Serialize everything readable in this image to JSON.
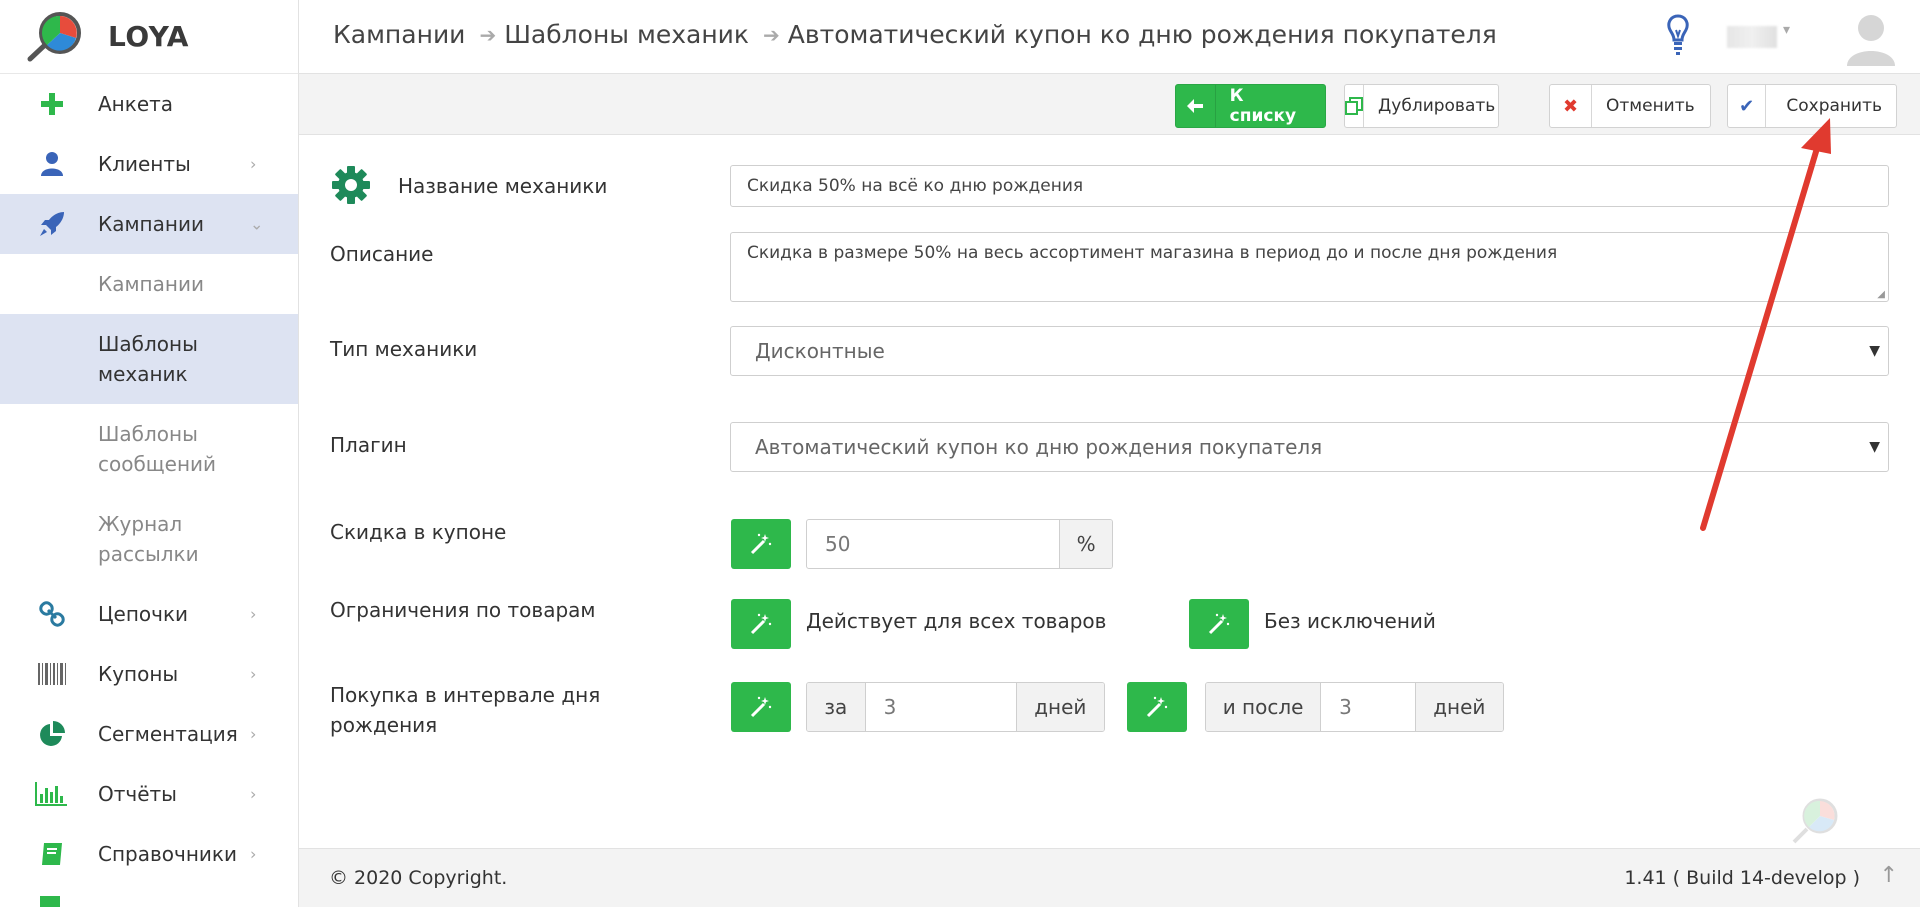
{
  "app": {
    "name": "LOYA"
  },
  "sidebar": {
    "items": [
      {
        "label": "Анкета",
        "icon": "plus-icon",
        "color": "#2eb84b"
      },
      {
        "label": "Клиенты",
        "icon": "user-icon",
        "color": "#3a64b8"
      },
      {
        "label": "Кампании",
        "icon": "rocket-icon",
        "color": "#3a64b8"
      },
      {
        "label": "Цепочки",
        "icon": "chain-icon",
        "color": "#2a7aa0"
      },
      {
        "label": "Купоны",
        "icon": "barcode-icon",
        "color": "#666666"
      },
      {
        "label": "Сегментация",
        "icon": "pie-chart-icon",
        "color": "#1e8a5a"
      },
      {
        "label": "Отчёты",
        "icon": "bar-chart-icon",
        "color": "#2eb84b"
      },
      {
        "label": "Справочники",
        "icon": "book-icon",
        "color": "#2eb84b"
      }
    ],
    "subitems": [
      {
        "label": "Кампании"
      },
      {
        "label": "Шаблоны механик"
      },
      {
        "label": "Шаблоны сообщений"
      },
      {
        "label": "Журнал рассылки"
      }
    ]
  },
  "header": {
    "breadcrumb": [
      "Кампании",
      "Шаблоны механик",
      "Автоматический купон ко дню рождения покупателя"
    ]
  },
  "toolbar": {
    "back_label": "К списку",
    "duplicate_label": "Дублировать",
    "cancel_label": "Отменить",
    "save_label": "Сохранить"
  },
  "form": {
    "name_label": "Название механики",
    "name_value": "Скидка 50% на всё ко дню рождения",
    "description_label": "Описание",
    "description_value": "Скидка в размере 50% на весь ассортимент магазина в период до и после дня рождения",
    "type_label": "Тип механики",
    "type_value": "Дисконтные",
    "plugin_label": "Плагин",
    "plugin_value": "Автоматический купон ко дню рождения покупателя",
    "discount_label": "Скидка в купоне",
    "discount_value": "50",
    "discount_unit": "%",
    "restrictions_label": "Ограничения по товарам",
    "restriction_goods": "Действует для всех товаров",
    "restriction_exceptions": "Без исключений",
    "interval_label": "Покупка в интервале дня рождения",
    "before_prefix": "за",
    "before_value": "3",
    "before_unit": "дней",
    "after_prefix": "и после",
    "after_value": "3",
    "after_unit": "дней"
  },
  "footer": {
    "copyright": "© 2020 Copyright.",
    "version": "1.41 ( Build 14-develop )"
  },
  "colors": {
    "accent_green": "#2eb84b",
    "active_bg": "#dde3f2",
    "annotation_red": "#e03a2f"
  }
}
